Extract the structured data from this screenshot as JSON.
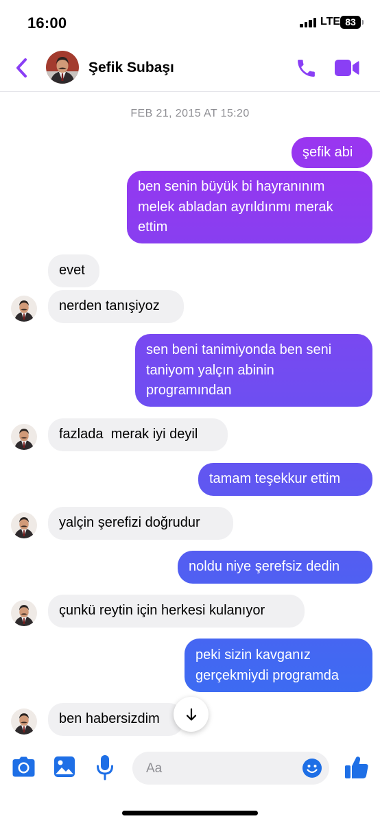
{
  "status_bar": {
    "time": "16:00",
    "network": "LTE",
    "battery": "83"
  },
  "header": {
    "contact_name": "Şefik Subaşı"
  },
  "conversation": {
    "timestamp": "FEB 21, 2015 AT 15:20",
    "messages": [
      {
        "from": "me",
        "lines": [
          "şefik abi"
        ]
      },
      {
        "from": "me",
        "lines": [
          "ben senin büyük bi hayranınım",
          "melek abladan ayrıldınmı merak",
          "ettim"
        ]
      },
      {
        "from": "them",
        "lines": [
          "evet"
        ]
      },
      {
        "from": "them",
        "lines": [
          "nerden tanışiyoz"
        ]
      },
      {
        "from": "me",
        "lines": [
          "sen beni tanimiyonda ben seni",
          "taniyom yalçın abinin",
          "programından"
        ]
      },
      {
        "from": "them",
        "lines": [
          "fazlada  merak iyi deyil"
        ]
      },
      {
        "from": "me",
        "lines": [
          "tamam teşekkur ettim"
        ]
      },
      {
        "from": "them",
        "lines": [
          "yalçin şerefizi doğrudur"
        ]
      },
      {
        "from": "me",
        "lines": [
          "noldu niye şerefsiz dedin"
        ]
      },
      {
        "from": "them",
        "lines": [
          "çunkü reytin için herkesi kulanıyor"
        ]
      },
      {
        "from": "me",
        "lines": [
          "peki sizin kavganız",
          "gerçekmiydi programda"
        ]
      },
      {
        "from": "them",
        "lines": [
          "ben habersizdim"
        ]
      }
    ]
  },
  "composer": {
    "placeholder": "Aa"
  },
  "icons": {
    "back": "chevron-left-icon",
    "call": "phone-icon",
    "video": "video-camera-icon",
    "camera": "camera-icon",
    "gallery": "image-icon",
    "mic": "microphone-icon",
    "emoji": "smiley-icon",
    "like": "thumbs-up-icon",
    "scroll": "arrow-down-icon"
  },
  "colors": {
    "accent": "#8a3ff5",
    "outgoing_top": "#9a35f0",
    "outgoing_bottom": "#3d6bf2",
    "incoming": "#f0f0f2",
    "composer_icons": "#1e6fe6"
  }
}
